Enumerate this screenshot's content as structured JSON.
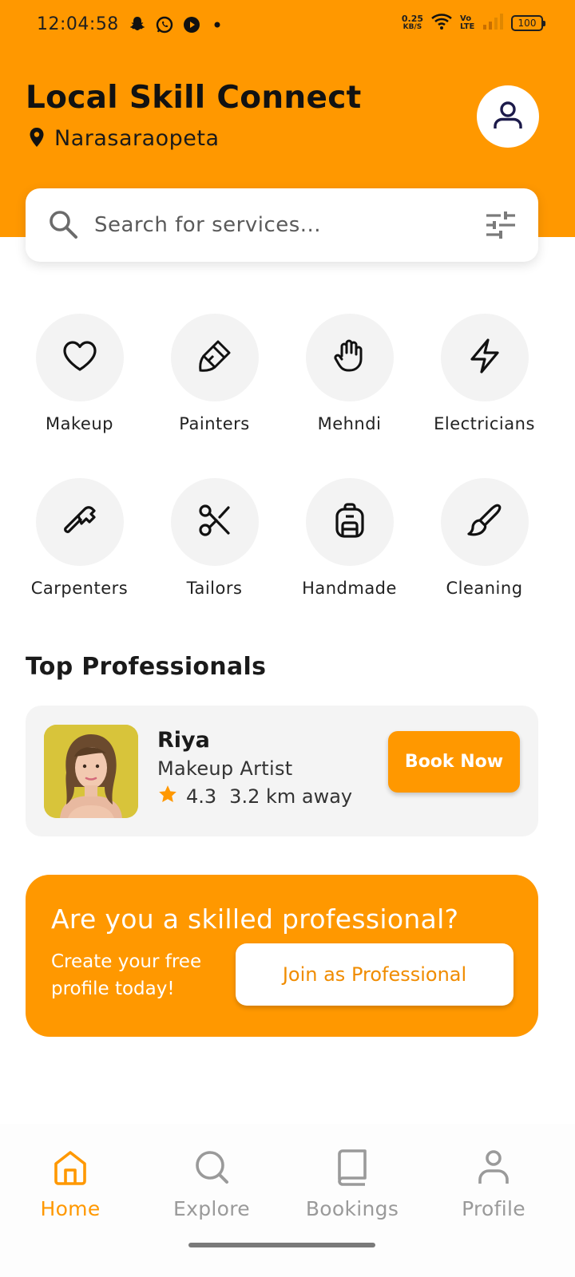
{
  "status_bar": {
    "time": "12:04:58",
    "net_speed_value": "0.25",
    "net_speed_unit": "KB/S",
    "volte": "Vo LTE",
    "battery": "100"
  },
  "header": {
    "title": "Local Skill Connect",
    "location": "Narasaraopeta"
  },
  "search": {
    "placeholder": "Search for services..."
  },
  "categories": [
    {
      "label": "Makeup",
      "icon": "heart-icon"
    },
    {
      "label": "Painters",
      "icon": "paintbrush-icon"
    },
    {
      "label": "Mehndi",
      "icon": "hand-icon"
    },
    {
      "label": "Electricians",
      "icon": "lightning-icon"
    },
    {
      "label": "Carpenters",
      "icon": "hammer-icon"
    },
    {
      "label": "Tailors",
      "icon": "scissors-icon"
    },
    {
      "label": "Handmade",
      "icon": "backpack-icon"
    },
    {
      "label": "Cleaning",
      "icon": "brush-icon"
    }
  ],
  "top_professionals": {
    "title": "Top Professionals",
    "items": [
      {
        "name": "Riya",
        "role": "Makeup Artist",
        "rating": "4.3",
        "distance": "3.2 km away",
        "button": "Book Now"
      }
    ]
  },
  "promo": {
    "title": "Are you a skilled professional?",
    "subtitle": "Create your free profile today!",
    "button": "Join as Professional"
  },
  "bottom_nav": [
    {
      "label": "Home",
      "icon": "home-icon",
      "active": true
    },
    {
      "label": "Explore",
      "icon": "search-icon",
      "active": false
    },
    {
      "label": "Bookings",
      "icon": "book-icon",
      "active": false
    },
    {
      "label": "Profile",
      "icon": "person-icon",
      "active": false
    }
  ],
  "colors": {
    "accent": "#FF9800",
    "inactive": "#9a9a9a",
    "text": "#1a1a1a"
  }
}
